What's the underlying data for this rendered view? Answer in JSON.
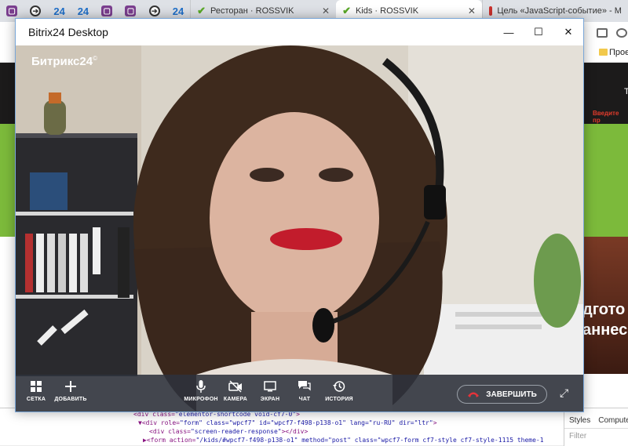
{
  "browser": {
    "pinned_tabs": [
      {
        "icon": "bitrix-app-icon",
        "text": ""
      },
      {
        "icon": "arrow-circle-icon",
        "text": ""
      },
      {
        "icon": "b24-icon",
        "text": "24"
      },
      {
        "icon": "b24-icon",
        "text": "24"
      },
      {
        "icon": "bitrix-app-icon",
        "text": ""
      },
      {
        "icon": "bitrix-app-icon",
        "text": ""
      },
      {
        "icon": "arrow-circle-icon",
        "text": ""
      },
      {
        "icon": "b24-icon",
        "text": "24"
      }
    ],
    "tabs": [
      {
        "title": "Ресторан · ROSSVIK",
        "active": false
      },
      {
        "title": "Kids · ROSSVIK",
        "active": true
      },
      {
        "title": "Цель «JavaScript-событие» - M",
        "active": false
      }
    ],
    "bookmark_label": "Прое"
  },
  "site": {
    "promo_text": "Введите пр",
    "letter": "T",
    "heading_line1": "дгото",
    "heading_line2": "аннес"
  },
  "devtools": {
    "lines": [
      {
        "tag": "<div class=",
        "val": "\"elementor-shortcode void-cf7-0\"",
        "end": ">"
      },
      {
        "tag": "▼<div role=",
        "val": "\"form\" class=\"wpcf7\" id=\"wpcf7-f498-p138-o1\" lang=\"ru-RU\" dir=\"ltr\"",
        "end": ">"
      },
      {
        "tag": "<div class=",
        "val": "\"screen-reader-response\"",
        "end": "></div>"
      },
      {
        "tag": "▶<form action=",
        "val": "\"/kids/#wpcf7-f498-p138-o1\" method=\"post\" class=\"wpcf7-form cf7-style cf7-style-1115 theme-1",
        "end": ""
      }
    ],
    "styles_tab": "Styles",
    "computed_tab": "Compute",
    "filter_placeholder": "Filter"
  },
  "app": {
    "window_title": "Bitrix24 Desktop",
    "logo_text": "Битрикс24",
    "logo_mark": "©",
    "controls": [
      {
        "icon": "grid-icon",
        "label": "СЕТКА"
      },
      {
        "icon": "plus-icon",
        "label": "ДОБАВИТЬ"
      },
      {
        "icon": "microphone-icon",
        "label": "МИКРОФОН"
      },
      {
        "icon": "camera-off-icon",
        "label": "КАМЕРА"
      },
      {
        "icon": "screen-icon",
        "label": "ЭКРАН"
      },
      {
        "icon": "chat-icon",
        "label": "ЧАТ"
      },
      {
        "icon": "history-icon",
        "label": "ИСТОРИЯ"
      }
    ],
    "end_call_label": "ЗАВЕРШИТЬ"
  },
  "colors": {
    "site_green": "#7cba3b",
    "end_call_red": "#e5333a",
    "window_border": "#7aa7d8"
  }
}
